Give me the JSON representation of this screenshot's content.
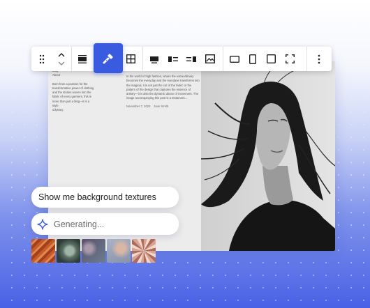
{
  "background": {
    "gradient_top": "#ffffff",
    "gradient_bottom": "#4961e5"
  },
  "accent": "#3a5ae0",
  "toolbar": {
    "items": [
      {
        "name": "drag-handle-icon"
      },
      {
        "name": "move-up-down-icon"
      },
      {
        "name": "align-cover-icon"
      },
      {
        "name": "ai-brush-icon",
        "active": true
      },
      {
        "name": "grid-icon"
      },
      {
        "name": "align-full-icon"
      },
      {
        "name": "media-left-icon"
      },
      {
        "name": "media-right-icon"
      },
      {
        "name": "image-icon"
      },
      {
        "name": "aspect-landscape-icon"
      },
      {
        "name": "aspect-portrait-icon"
      },
      {
        "name": "aspect-square-icon"
      },
      {
        "name": "fullscreen-icon"
      },
      {
        "name": "more-options-icon"
      }
    ]
  },
  "post": {
    "nav1": "Blog",
    "nav2": "About",
    "intro": "Born from a passion for the\ntransformative power of clothing\nand the stories woven into the\nfabric of every garment, this is\nmore than just a blog—it is a style\nodyssey.",
    "excerpt": "In the world of high fashion, where the extraordinary\nbecomes the everyday and the mundane transforms into\nthe magical, it is not just the cut of the fabric or the\npattern of the design that captures the essence of\nartistry—it is also the dynamic dance of movement. The\nimage accompanying this post is a testament...",
    "date": "November 7, 2023",
    "author": "Joan Smith"
  },
  "chat": {
    "prompt": "Show me background textures",
    "status": "Generating..."
  },
  "thumbnails": [
    {
      "name": "orange-texture",
      "colors": [
        "#c85a2a",
        "#e0894f",
        "#a3401c"
      ]
    },
    {
      "name": "green-texture",
      "colors": [
        "#2e3d38",
        "#9fb5a8",
        "#5b6e63"
      ]
    },
    {
      "name": "blurred-texture",
      "colors": [
        "#5c4f6e",
        "#a89aa8",
        "#6b7e8f"
      ]
    },
    {
      "name": "pastel-texture",
      "colors": [
        "#a9b2c6",
        "#d9b7a4",
        "#8a93a8"
      ]
    },
    {
      "name": "kaleidoscope-texture",
      "colors": [
        "#d8a391",
        "#f1d9cf",
        "#b06a5b"
      ]
    }
  ]
}
